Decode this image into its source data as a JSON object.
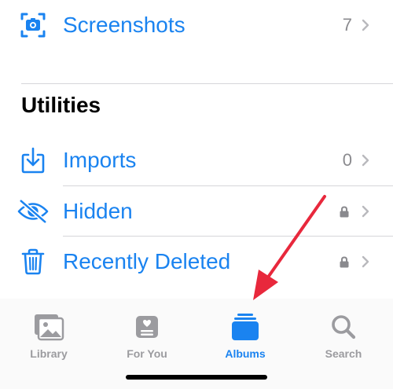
{
  "colors": {
    "accent": "#1a83f0",
    "secondary": "#8a8a8e",
    "arrow": "#e8283c"
  },
  "albums": [
    {
      "label": "Screenshots",
      "count": "7",
      "icon": "screenshot-icon"
    }
  ],
  "utilities": {
    "title": "Utilities",
    "items": [
      {
        "label": "Imports",
        "count": "0",
        "icon": "import-icon"
      },
      {
        "label": "Hidden",
        "icon": "eye-slash-icon",
        "locked": true
      },
      {
        "label": "Recently Deleted",
        "icon": "trash-icon",
        "locked": true
      }
    ]
  },
  "tabbar": {
    "tabs": [
      {
        "label": "Library",
        "icon": "photos-icon",
        "active": false
      },
      {
        "label": "For You",
        "icon": "for-you-icon",
        "active": false
      },
      {
        "label": "Albums",
        "icon": "albums-icon",
        "active": true
      },
      {
        "label": "Search",
        "icon": "search-icon",
        "active": false
      }
    ]
  }
}
